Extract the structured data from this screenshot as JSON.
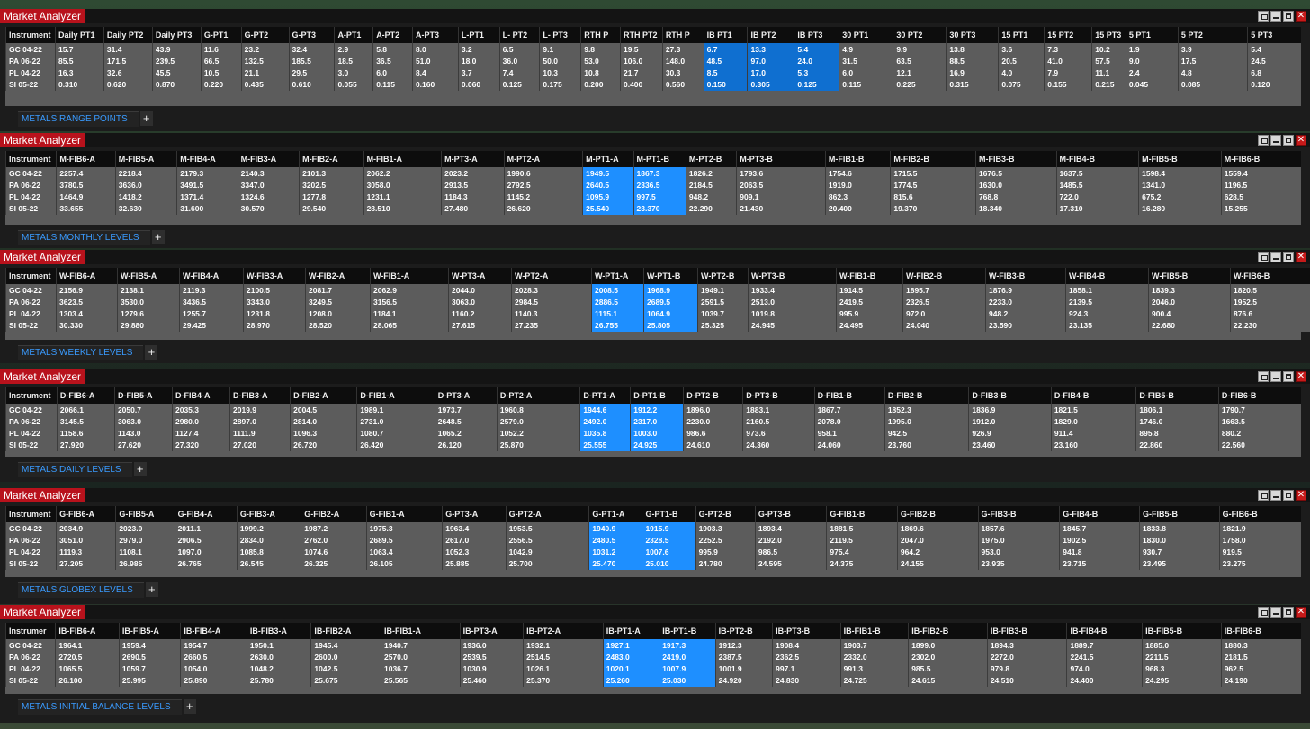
{
  "window_title": "Market Analyzer",
  "panels": [
    {
      "tab": "METALS RANGE POINTS",
      "columns": [
        "Instrument",
        "Daily PT1",
        "Daily PT2",
        "Daily PT3",
        "G-PT1",
        "G-PT2",
        "G-PT3",
        "A-PT1",
        "A-PT2",
        "A-PT3",
        "L-PT1",
        "L- PT2",
        "L- PT3",
        "RTH P",
        "RTH PT2",
        "RTH P",
        "IB PT1",
        "IB PT2",
        "IB PT3",
        "30 PT1",
        "30 PT2",
        "30 PT3",
        "15 PT1",
        "15 PT2",
        "15 PT3",
        "5 PT1",
        "5 PT2",
        "5 PT3"
      ],
      "highlight_cols": [
        16,
        17,
        18
      ],
      "rows": [
        [
          "GC 04-22",
          "15.7",
          "31.4",
          "43.9",
          "11.6",
          "23.2",
          "32.4",
          "2.9",
          "5.8",
          "8.0",
          "3.2",
          "6.5",
          "9.1",
          "9.8",
          "19.5",
          "27.3",
          "6.7",
          "13.3",
          "5.4",
          "4.9",
          "9.9",
          "13.8",
          "3.6",
          "7.3",
          "10.2",
          "1.9",
          "3.9",
          "5.4"
        ],
        [
          "PA 06-22",
          "85.5",
          "171.5",
          "239.5",
          "66.5",
          "132.5",
          "185.5",
          "18.5",
          "36.5",
          "51.0",
          "18.0",
          "36.0",
          "50.0",
          "53.0",
          "106.0",
          "148.0",
          "48.5",
          "97.0",
          "24.0",
          "31.5",
          "63.5",
          "88.5",
          "20.5",
          "41.0",
          "57.5",
          "9.0",
          "17.5",
          "24.5"
        ],
        [
          "PL 04-22",
          "16.3",
          "32.6",
          "45.5",
          "10.5",
          "21.1",
          "29.5",
          "3.0",
          "6.0",
          "8.4",
          "3.7",
          "7.4",
          "10.3",
          "10.8",
          "21.7",
          "30.3",
          "8.5",
          "17.0",
          "5.3",
          "6.0",
          "12.1",
          "16.9",
          "4.0",
          "7.9",
          "11.1",
          "2.4",
          "4.8",
          "6.8"
        ],
        [
          "SI 05-22",
          "0.310",
          "0.620",
          "0.870",
          "0.220",
          "0.435",
          "0.610",
          "0.055",
          "0.115",
          "0.160",
          "0.060",
          "0.125",
          "0.175",
          "0.200",
          "0.400",
          "0.560",
          "0.150",
          "0.305",
          "0.125",
          "0.115",
          "0.225",
          "0.315",
          "0.075",
          "0.155",
          "0.215",
          "0.045",
          "0.085",
          "0.120"
        ]
      ]
    },
    {
      "tab": "METALS MONTHLY LEVELS",
      "columns": [
        "Instrument",
        "M-FIB6-A",
        "M-FIB5-A",
        "M-FIB4-A",
        "M-FIB3-A",
        "M-FIB2-A",
        "M-FIB1-A",
        "M-PT3-A",
        "M-PT2-A",
        "M-PT1-A",
        "M-PT1-B",
        "M-PT2-B",
        "M-PT3-B",
        "M-FIB1-B",
        "M-FIB2-B",
        "M-FIB3-B",
        "M-FIB4-B",
        "M-FIB5-B",
        "M-FIB6-B"
      ],
      "highlight_cols": [
        9,
        10
      ],
      "rows": [
        [
          "GC 04-22",
          "2257.4",
          "2218.4",
          "2179.3",
          "2140.3",
          "2101.3",
          "2062.2",
          "2023.2",
          "1990.6",
          "1949.5",
          "1867.3",
          "1826.2",
          "1793.6",
          "1754.6",
          "1715.5",
          "1676.5",
          "1637.5",
          "1598.4",
          "1559.4"
        ],
        [
          "PA 06-22",
          "3780.5",
          "3636.0",
          "3491.5",
          "3347.0",
          "3202.5",
          "3058.0",
          "2913.5",
          "2792.5",
          "2640.5",
          "2336.5",
          "2184.5",
          "2063.5",
          "1919.0",
          "1774.5",
          "1630.0",
          "1485.5",
          "1341.0",
          "1196.5"
        ],
        [
          "PL 04-22",
          "1464.9",
          "1418.2",
          "1371.4",
          "1324.6",
          "1277.8",
          "1231.1",
          "1184.3",
          "1145.2",
          "1095.9",
          "997.5",
          "948.2",
          "909.1",
          "862.3",
          "815.6",
          "768.8",
          "722.0",
          "675.2",
          "628.5"
        ],
        [
          "SI 05-22",
          "33.655",
          "32.630",
          "31.600",
          "30.570",
          "29.540",
          "28.510",
          "27.480",
          "26.620",
          "25.540",
          "23.370",
          "22.290",
          "21.430",
          "20.400",
          "19.370",
          "18.340",
          "17.310",
          "16.280",
          "15.255"
        ]
      ]
    },
    {
      "tab": "METALS WEEKLY LEVELS",
      "columns": [
        "Instrument",
        "W-FIB6-A",
        "W-FIB5-A",
        "W-FIB4-A",
        "W-FIB3-A",
        "W-FIB2-A",
        "W-FIB1-A",
        "W-PT3-A",
        "W-PT2-A",
        "W-PT1-A",
        "W-PT1-B",
        "W-PT2-B",
        "W-PT3-B",
        "W-FIB1-B",
        "W-FIB2-B",
        "W-FIB3-B",
        "W-FIB4-B",
        "W-FIB5-B",
        "W-FIB6-B"
      ],
      "highlight_cols": [
        9,
        10
      ],
      "rows": [
        [
          "GC 04-22",
          "2156.9",
          "2138.1",
          "2119.3",
          "2100.5",
          "2081.7",
          "2062.9",
          "2044.0",
          "2028.3",
          "2008.5",
          "1968.9",
          "1949.1",
          "1933.4",
          "1914.5",
          "1895.7",
          "1876.9",
          "1858.1",
          "1839.3",
          "1820.5"
        ],
        [
          "PA 06-22",
          "3623.5",
          "3530.0",
          "3436.5",
          "3343.0",
          "3249.5",
          "3156.5",
          "3063.0",
          "2984.5",
          "2886.5",
          "2689.5",
          "2591.5",
          "2513.0",
          "2419.5",
          "2326.5",
          "2233.0",
          "2139.5",
          "2046.0",
          "1952.5"
        ],
        [
          "PL 04-22",
          "1303.4",
          "1279.6",
          "1255.7",
          "1231.8",
          "1208.0",
          "1184.1",
          "1160.2",
          "1140.3",
          "1115.1",
          "1064.9",
          "1039.7",
          "1019.8",
          "995.9",
          "972.0",
          "948.2",
          "924.3",
          "900.4",
          "876.6"
        ],
        [
          "SI 05-22",
          "30.330",
          "29.880",
          "29.425",
          "28.970",
          "28.520",
          "28.065",
          "27.615",
          "27.235",
          "26.755",
          "25.805",
          "25.325",
          "24.945",
          "24.495",
          "24.040",
          "23.590",
          "23.135",
          "22.680",
          "22.230"
        ]
      ]
    },
    {
      "tab": "METALS DAILY LEVELS",
      "columns": [
        "Instrument",
        "D-FIB6-A",
        "D-FIB5-A",
        "D-FIB4-A",
        "D-FIB3-A",
        "D-FIB2-A",
        "D-FIB1-A",
        "D-PT3-A",
        "D-PT2-A",
        "D-PT1-A",
        "D-PT1-B",
        "D-PT2-B",
        "D-PT3-B",
        "D-FIB1-B",
        "D-FIB2-B",
        "D-FIB3-B",
        "D-FIB4-B",
        "D-FIB5-B",
        "D-FIB6-B"
      ],
      "highlight_cols": [
        9,
        10
      ],
      "rows": [
        [
          "GC 04-22",
          "2066.1",
          "2050.7",
          "2035.3",
          "2019.9",
          "2004.5",
          "1989.1",
          "1973.7",
          "1960.8",
          "1944.6",
          "1912.2",
          "1896.0",
          "1883.1",
          "1867.7",
          "1852.3",
          "1836.9",
          "1821.5",
          "1806.1",
          "1790.7"
        ],
        [
          "PA 06-22",
          "3145.5",
          "3063.0",
          "2980.0",
          "2897.0",
          "2814.0",
          "2731.0",
          "2648.5",
          "2579.0",
          "2492.0",
          "2317.0",
          "2230.0",
          "2160.5",
          "2078.0",
          "1995.0",
          "1912.0",
          "1829.0",
          "1746.0",
          "1663.5"
        ],
        [
          "PL 04-22",
          "1158.6",
          "1143.0",
          "1127.4",
          "1111.9",
          "1096.3",
          "1080.7",
          "1065.2",
          "1052.2",
          "1035.8",
          "1003.0",
          "986.6",
          "973.6",
          "958.1",
          "942.5",
          "926.9",
          "911.4",
          "895.8",
          "880.2"
        ],
        [
          "SI 05-22",
          "27.920",
          "27.620",
          "27.320",
          "27.020",
          "26.720",
          "26.420",
          "26.120",
          "25.870",
          "25.555",
          "24.925",
          "24.610",
          "24.360",
          "24.060",
          "23.760",
          "23.460",
          "23.160",
          "22.860",
          "22.560"
        ]
      ]
    },
    {
      "tab": "METALS GLOBEX LEVELS",
      "columns": [
        "Instrument",
        "G-FIB6-A",
        "G-FIB5-A",
        "G-FIB4-A",
        "G-FIB3-A",
        "G-FIB2-A",
        "G-FIB1-A",
        "G-PT3-A",
        "G-PT2-A",
        "G-PT1-A",
        "G-PT1-B",
        "G-PT2-B",
        "G-PT3-B",
        "G-FIB1-B",
        "G-FIB2-B",
        "G-FIB3-B",
        "G-FIB4-B",
        "G-FIB5-B",
        "G-FIB6-B"
      ],
      "highlight_cols": [
        9,
        10
      ],
      "rows": [
        [
          "GC 04-22",
          "2034.9",
          "2023.0",
          "2011.1",
          "1999.2",
          "1987.2",
          "1975.3",
          "1963.4",
          "1953.5",
          "1940.9",
          "1915.9",
          "1903.3",
          "1893.4",
          "1881.5",
          "1869.6",
          "1857.6",
          "1845.7",
          "1833.8",
          "1821.9"
        ],
        [
          "PA 06-22",
          "3051.0",
          "2979.0",
          "2906.5",
          "2834.0",
          "2762.0",
          "2689.5",
          "2617.0",
          "2556.5",
          "2480.5",
          "2328.5",
          "2252.5",
          "2192.0",
          "2119.5",
          "2047.0",
          "1975.0",
          "1902.5",
          "1830.0",
          "1758.0"
        ],
        [
          "PL 04-22",
          "1119.3",
          "1108.1",
          "1097.0",
          "1085.8",
          "1074.6",
          "1063.4",
          "1052.3",
          "1042.9",
          "1031.2",
          "1007.6",
          "995.9",
          "986.5",
          "975.4",
          "964.2",
          "953.0",
          "941.8",
          "930.7",
          "919.5"
        ],
        [
          "SI 05-22",
          "27.205",
          "26.985",
          "26.765",
          "26.545",
          "26.325",
          "26.105",
          "25.885",
          "25.700",
          "25.470",
          "25.010",
          "24.780",
          "24.595",
          "24.375",
          "24.155",
          "23.935",
          "23.715",
          "23.495",
          "23.275"
        ]
      ]
    },
    {
      "tab": "METALS  INITIAL BALANCE LEVELS",
      "columns": [
        "Instrumer",
        "IB-FIB6-A",
        "IB-FIB5-A",
        "IB-FIB4-A",
        "IB-FIB3-A",
        "IB-FIB2-A",
        "IB-FIB1-A",
        "IB-PT3-A",
        "IB-PT2-A",
        "IB-PT1-A",
        "IB-PT1-B",
        "IB-PT2-B",
        "IB-PT3-B",
        "IB-FIB1-B",
        "IB-FIB2-B",
        "IB-FIB3-B",
        "IB-FIB4-B",
        "IB-FIB5-B",
        "IB-FIB6-B"
      ],
      "highlight_cols": [
        9,
        10
      ],
      "rows": [
        [
          "GC 04-22",
          "1964.1",
          "1959.4",
          "1954.7",
          "1950.1",
          "1945.4",
          "1940.7",
          "1936.0",
          "1932.1",
          "1927.1",
          "1917.3",
          "1912.3",
          "1908.4",
          "1903.7",
          "1899.0",
          "1894.3",
          "1889.7",
          "1885.0",
          "1880.3"
        ],
        [
          "PA 06-22",
          "2720.5",
          "2690.5",
          "2660.5",
          "2630.0",
          "2600.0",
          "2570.0",
          "2539.5",
          "2514.5",
          "2483.0",
          "2419.0",
          "2387.5",
          "2362.5",
          "2332.0",
          "2302.0",
          "2272.0",
          "2241.5",
          "2211.5",
          "2181.5"
        ],
        [
          "PL 04-22",
          "1065.5",
          "1059.7",
          "1054.0",
          "1048.2",
          "1042.5",
          "1036.7",
          "1030.9",
          "1026.1",
          "1020.1",
          "1007.9",
          "1001.9",
          "997.1",
          "991.3",
          "985.5",
          "979.8",
          "974.0",
          "968.3",
          "962.5"
        ],
        [
          "SI 05-22",
          "26.100",
          "25.995",
          "25.890",
          "25.780",
          "25.675",
          "25.565",
          "25.460",
          "25.370",
          "25.260",
          "25.030",
          "24.920",
          "24.830",
          "24.725",
          "24.615",
          "24.510",
          "24.400",
          "24.295",
          "24.190"
        ]
      ]
    }
  ]
}
